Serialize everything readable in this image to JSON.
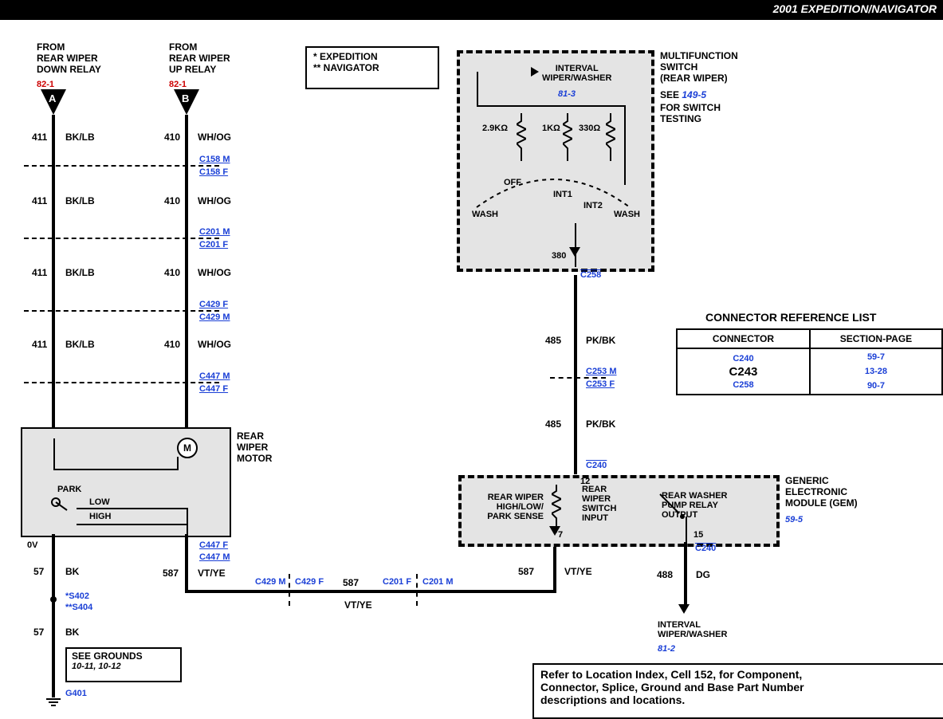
{
  "header": {
    "title": "2001 EXPEDITION/NAVIGATOR"
  },
  "legend": {
    "line1": "* EXPEDITION",
    "line2": "** NAVIGATOR"
  },
  "relayA": {
    "from": "FROM\nREAR WIPER\nDOWN RELAY",
    "ref": "82-1",
    "label": "A"
  },
  "relayB": {
    "from": "FROM\nREAR WIPER\nUP RELAY",
    "ref": "82-1",
    "label": "B"
  },
  "wiresA": {
    "n": "411",
    "c": "BK/LB"
  },
  "wiresB": {
    "n": "410",
    "c": "WH/OG"
  },
  "connB": {
    "c158m": "C158 M",
    "c158f": "C158 F",
    "c201m": "C201 M",
    "c201f": "C201 F",
    "c429f": "C429 F",
    "c429m": "C429 M",
    "c447m": "C447 M",
    "c447f": "C447 F"
  },
  "motor": {
    "label": "REAR\nWIPER\nMOTOR",
    "m": "M",
    "park": "PARK",
    "low": "LOW",
    "high": "HIGH"
  },
  "ground": {
    "ov": "0V",
    "n57": "57",
    "bk": "BK",
    "s402": "*S402",
    "s404": "**S404",
    "see": "SEE GROUNDS",
    "pages": "10-11, 10-12",
    "g401": "G401"
  },
  "vtye": {
    "n587": "587",
    "c": "VT/YE",
    "c447f": "C447 F",
    "c447m": "C447 M",
    "c429m": "C429 M",
    "c429f": "C429 F",
    "c201f": "C201 F",
    "c201m": "C201 M"
  },
  "multi": {
    "title": "MULTIFUNCTION\nSWITCH\n(REAR WIPER)",
    "see": "SEE",
    "seeRef": "149-5",
    "rest": "FOR SWITCH\nTESTING",
    "interval": "INTERVAL\nWIPER/WASHER",
    "intervalRef": "81-3",
    "r1": "2.9KΩ",
    "r2": "1KΩ",
    "r3": "330Ω",
    "off": "OFF",
    "wash1": "WASH",
    "int1": "INT1",
    "int2": "INT2",
    "wash2": "WASH",
    "pin": "380",
    "c258": "C258"
  },
  "pkbk": {
    "n485": "485",
    "c": "PK/BK",
    "c253m": "C253 M",
    "c253f": "C253 F",
    "c240": "C240"
  },
  "gem": {
    "title": "GENERIC\nELECTRONIC\nMODULE (GEM)",
    "ref": "59-5",
    "a": "REAR WIPER\nHIGH/LOW/\nPARK SENSE",
    "b": "REAR\nWIPER\nSWITCH\nINPUT",
    "c": "REAR WASHER\nPUMP RELAY\nOUTPUT",
    "p7": "7",
    "p12": "12",
    "p15": "15",
    "c240b": "C240"
  },
  "dg": {
    "n488": "488",
    "c": "DG",
    "lbl": "INTERVAL\nWIPER/WASHER",
    "ref": "81-2"
  },
  "reftable": {
    "title": "CONNECTOR REFERENCE LIST",
    "h1": "CONNECTOR",
    "h2": "SECTION-PAGE",
    "r1c1": "C240",
    "r1c2": "59-7",
    "r2c1": "C243",
    "r2c2": "13-28",
    "r3c1": "C258",
    "r3c2": "90-7"
  },
  "footnote": "Refer to Location Index, Cell 152, for Component,\nConnector, Splice, Ground and Base Part Number\ndescriptions and locations."
}
